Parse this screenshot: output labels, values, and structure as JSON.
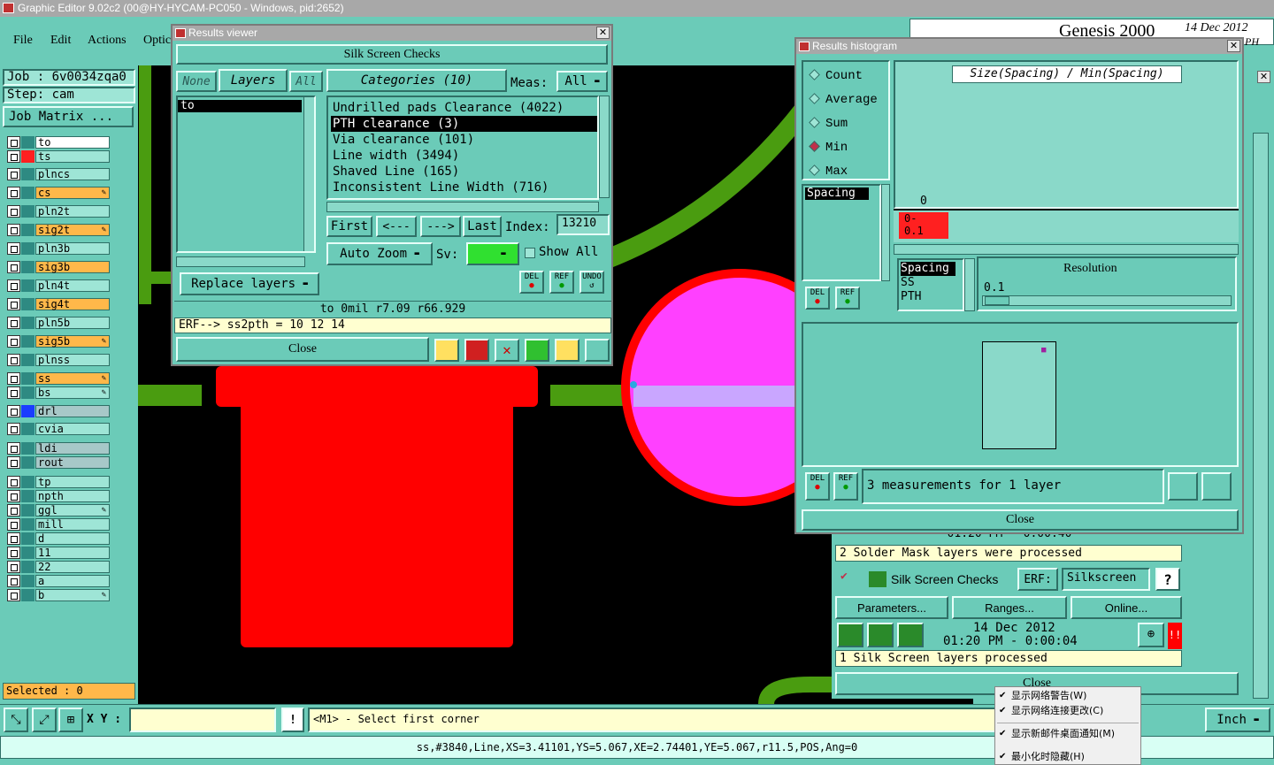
{
  "app": {
    "title": "Graphic Editor 9.02c2 (00@HY-HYCAM-PC050 - Windows, pid:2652)"
  },
  "menu": {
    "items": [
      "File",
      "Edit",
      "Actions",
      "Optic"
    ]
  },
  "job": {
    "job_label": "Job : 6v0034zqa0",
    "step_label": "Step: cam",
    "matrix_button": "Job Matrix ..."
  },
  "layers": [
    {
      "name": "to",
      "swatch": "#2e8a82",
      "style": "w"
    },
    {
      "name": "ts",
      "swatch": "#ff2020",
      "style": ""
    },
    {
      "name": "plncs",
      "swatch": "",
      "style": ""
    },
    {
      "name": "cs",
      "swatch": "",
      "style": "o",
      "pen": true
    },
    {
      "name": "pln2t",
      "swatch": "",
      "style": ""
    },
    {
      "name": "sig2t",
      "swatch": "",
      "style": "o",
      "pen": true
    },
    {
      "name": "pln3b",
      "swatch": "",
      "style": ""
    },
    {
      "name": "sig3b",
      "swatch": "",
      "style": "o"
    },
    {
      "name": "pln4t",
      "swatch": "",
      "style": ""
    },
    {
      "name": "sig4t",
      "swatch": "",
      "style": "o"
    },
    {
      "name": "pln5b",
      "swatch": "",
      "style": ""
    },
    {
      "name": "sig5b",
      "swatch": "",
      "style": "o",
      "pen": true
    },
    {
      "name": "plnss",
      "swatch": "",
      "style": ""
    },
    {
      "name": "ss",
      "swatch": "",
      "style": "o",
      "pen": true
    },
    {
      "name": "bs",
      "swatch": "",
      "style": "",
      "pen": true
    },
    {
      "name": "drl",
      "swatch": "#1a3cff",
      "style": "g"
    },
    {
      "name": "cvia",
      "swatch": "",
      "style": ""
    },
    {
      "name": "ldi",
      "swatch": "",
      "style": "g"
    },
    {
      "name": "rout",
      "swatch": "",
      "style": "g"
    },
    {
      "name": "tp",
      "swatch": "",
      "style": ""
    },
    {
      "name": "npth",
      "swatch": "",
      "style": ""
    },
    {
      "name": "ggl",
      "swatch": "",
      "style": "",
      "pen": true
    },
    {
      "name": "mill",
      "swatch": "",
      "style": ""
    },
    {
      "name": "d",
      "swatch": "",
      "style": ""
    },
    {
      "name": "11",
      "swatch": "",
      "style": ""
    },
    {
      "name": "22",
      "swatch": "",
      "style": ""
    },
    {
      "name": "a",
      "swatch": "",
      "style": ""
    },
    {
      "name": "b",
      "swatch": "",
      "style": "",
      "pen": true
    }
  ],
  "selected": "Selected : 0",
  "results_viewer": {
    "title": "Results viewer",
    "header": "Silk Screen Checks",
    "none_btn": "None",
    "layers_btn": "Layers",
    "all_btn": "All",
    "layer_list": [
      "to"
    ],
    "categories_btn": "Categories (10)",
    "meas_label": "Meas:",
    "meas_value": "All",
    "categories": [
      "Undrilled pads Clearance (4022)",
      "PTH clearance (3)",
      "Via clearance (101)",
      "Line width (3494)",
      "Shaved Line (165)",
      "Inconsistent Line Width (716)"
    ],
    "selected_category": 1,
    "first": "First",
    "prev": "<---",
    "next": "--->",
    "last": "Last",
    "index_label": "Index:",
    "index_value": "13210",
    "auto_zoom": "Auto Zoom",
    "sv_label": "Sv:",
    "show_all": "Show All",
    "replace_layers": "Replace layers",
    "del": "DEL",
    "ref": "REF",
    "undo": "UNDO",
    "status": "to 0mil   r7.09   r66.929",
    "erf_line": "ERF--> ss2pth = 10 12 14",
    "close": "Close"
  },
  "histogram": {
    "title": "Results histogram",
    "options": [
      "Count",
      "Average",
      "Sum",
      "Min",
      "Max"
    ],
    "selected_option": "Min",
    "chart_title": "Size(Spacing) / Min(Spacing)",
    "zero_label": "0",
    "bar_label": "0-\n0.1",
    "spacing_list": [
      "Spacing"
    ],
    "attr_list": [
      "Spacing",
      "SS",
      "PTH"
    ],
    "resolution_label": "Resolution",
    "resolution_value": "0.1",
    "measure_text": "3 measurements for 1 layer",
    "close": "Close"
  },
  "genesis": {
    "title": "Genesis 2000",
    "date": "14 Dec 2012",
    "sub": "PH"
  },
  "checklist": {
    "row0_time": "01:20 PM - 0:00:40",
    "solder_text": "2 Solder Mask layers were processed",
    "silk_name": "Silk Screen Checks",
    "erf_label": "ERF:",
    "erf_value": "Silkscreen",
    "help": "?",
    "parameters": "Parameters...",
    "ranges": "Ranges...",
    "online": "Online...",
    "date": "14 Dec 2012",
    "time": "01:20 PM - 0:00:04",
    "silk_processed": "1 Silk Screen layers processed",
    "close": "Close"
  },
  "context_menu": [
    "显示网络警告(W)",
    "显示网络连接更改(C)",
    "显示新邮件桌面通知(M)",
    "最小化时隐藏(H)"
  ],
  "bottom": {
    "xy_label": "X Y :",
    "hint": "<M1> - Select first corner",
    "unit": "Inch",
    "status": "ss,#3840,Line,XS=3.41101,YS=5.067,XE=2.74401,YE=5.067,r11.5,POS,Ang=0"
  },
  "colors": {
    "panel": "#6bcbb8",
    "canvas": "#000000",
    "trace": "#4a9c10",
    "pad": "#ff0000",
    "highlight": "#ff00ff",
    "orange": "#ffb84a"
  }
}
